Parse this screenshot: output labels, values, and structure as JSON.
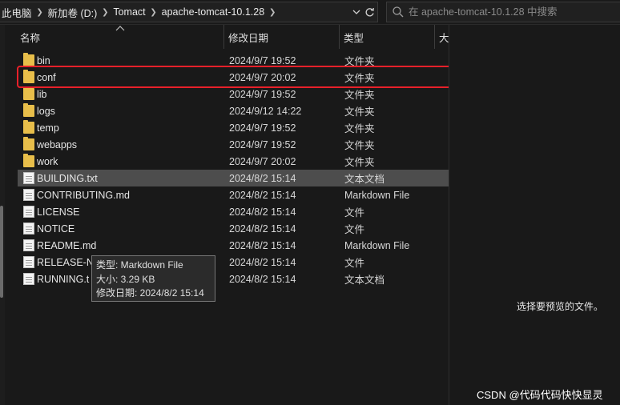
{
  "address_bar": {
    "crumbs": [
      "此电脑",
      "新加卷 (D:)",
      "Tomact",
      "apache-tomcat-10.1.28"
    ]
  },
  "search": {
    "placeholder": "在 apache-tomcat-10.1.28 中搜索"
  },
  "columns": {
    "name": "名称",
    "date": "修改日期",
    "type": "类型",
    "size": "大"
  },
  "files": [
    {
      "name": "bin",
      "date": "2024/9/7 19:52",
      "type": "文件夹",
      "icon": "folder-icon"
    },
    {
      "name": "conf",
      "date": "2024/9/7 20:02",
      "type": "文件夹",
      "icon": "folder-icon"
    },
    {
      "name": "lib",
      "date": "2024/9/7 19:52",
      "type": "文件夹",
      "icon": "folder-icon"
    },
    {
      "name": "logs",
      "date": "2024/9/12 14:22",
      "type": "文件夹",
      "icon": "folder-icon"
    },
    {
      "name": "temp",
      "date": "2024/9/7 19:52",
      "type": "文件夹",
      "icon": "folder-icon"
    },
    {
      "name": "webapps",
      "date": "2024/9/7 19:52",
      "type": "文件夹",
      "icon": "folder-icon"
    },
    {
      "name": "work",
      "date": "2024/9/7 20:02",
      "type": "文件夹",
      "icon": "folder-icon"
    },
    {
      "name": "BUILDING.txt",
      "date": "2024/8/2 15:14",
      "type": "文本文档",
      "icon": "text-file-icon"
    },
    {
      "name": "CONTRIBUTING.md",
      "date": "2024/8/2 15:14",
      "type": "Markdown File",
      "icon": "markdown-file-icon"
    },
    {
      "name": "LICENSE",
      "date": "2024/8/2 15:14",
      "type": "文件",
      "icon": "file-icon"
    },
    {
      "name": "NOTICE",
      "date": "2024/8/2 15:14",
      "type": "文件",
      "icon": "file-icon"
    },
    {
      "name": "README.md",
      "date": "2024/8/2 15:14",
      "type": "Markdown File",
      "icon": "markdown-file-icon"
    },
    {
      "name": "RELEASE-NO",
      "date": "2024/8/2 15:14",
      "type": "文件",
      "icon": "file-icon"
    },
    {
      "name": "RUNNING.t",
      "date": "2024/8/2 15:14",
      "type": "文本文档",
      "icon": "text-file-icon"
    }
  ],
  "tooltip": {
    "line1": "类型: Markdown File",
    "line2": "大小: 3.29 KB",
    "line3": "修改日期: 2024/8/2 15:14"
  },
  "preview": {
    "message": "选择要预览的文件。"
  },
  "watermark": "CSDN @代码代码快快显灵",
  "colors": {
    "highlight": "#e8202a",
    "folder": "#e8be4a",
    "selected_row": "#4d4d4d"
  }
}
